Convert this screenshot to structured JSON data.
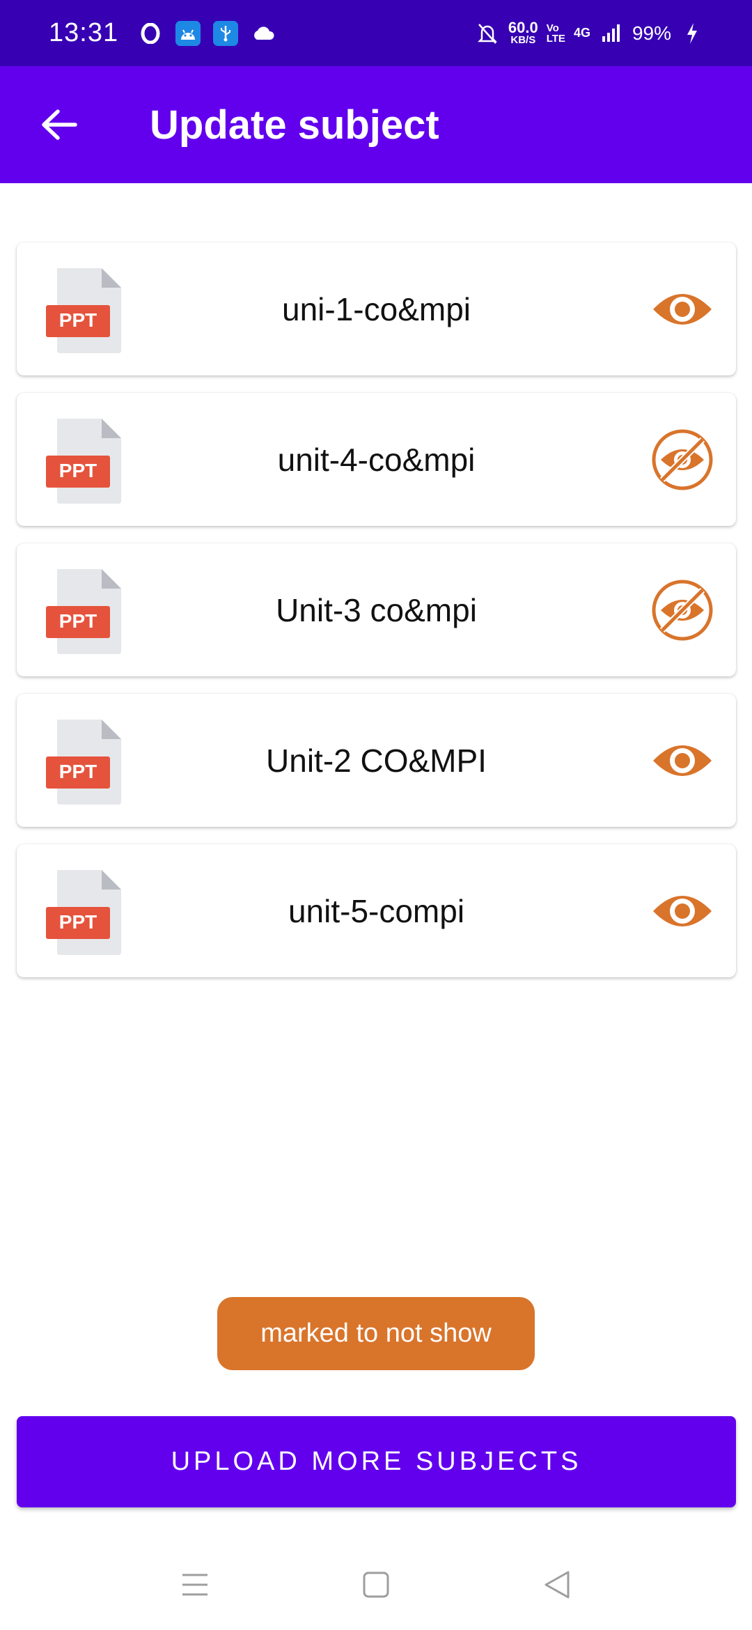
{
  "status_bar": {
    "time": "13:31",
    "net_speed_value": "60.0",
    "net_speed_unit": "KB/S",
    "volte_top": "Vo",
    "volte_bottom": "LTE",
    "network": "4G",
    "battery": "99%"
  },
  "app_bar": {
    "title": "Update subject"
  },
  "subjects": [
    {
      "name": "uni-1-co&mpi",
      "file_type": "PPT",
      "visible": true
    },
    {
      "name": "unit-4-co&mpi",
      "file_type": "PPT",
      "visible": false
    },
    {
      "name": "Unit-3 co&mpi",
      "file_type": "PPT",
      "visible": false
    },
    {
      "name": "Unit-2 CO&MPI",
      "file_type": "PPT",
      "visible": true
    },
    {
      "name": "unit-5-compi",
      "file_type": "PPT",
      "visible": true
    }
  ],
  "toast": {
    "message": "marked to not show"
  },
  "upload_button": {
    "label": "UPLOAD MORE SUBJECTS"
  },
  "colors": {
    "status_bar": "#3700b3",
    "primary": "#6200ee",
    "accent_orange": "#d9742b",
    "ppt_red": "#e5533c"
  }
}
